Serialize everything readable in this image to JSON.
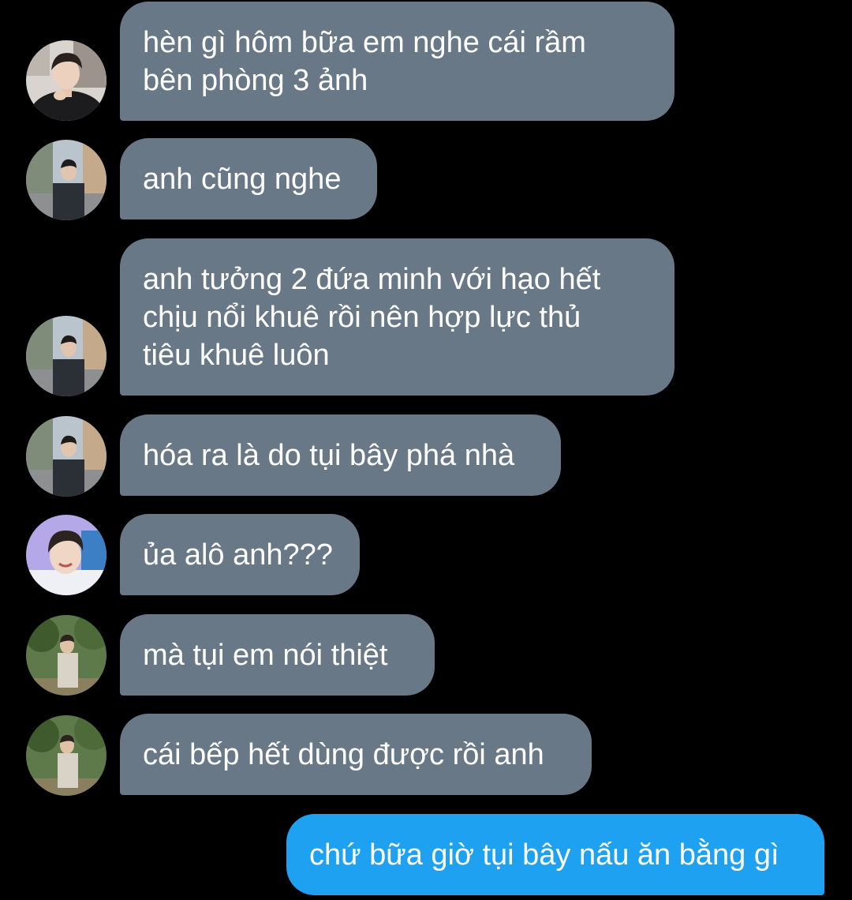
{
  "colors": {
    "background": "#000000",
    "incoming_bubble": "#697887",
    "outgoing_bubble": "#1fa1f2",
    "text": "#ffffff"
  },
  "messages": [
    {
      "direction": "incoming",
      "avatar": "avatar-dark-jacket",
      "text": "hèn gì hôm bữa em nghe cái rầm\nbên phòng 3 ảnh"
    },
    {
      "direction": "incoming",
      "avatar": "avatar-street",
      "text": "anh cũng nghe"
    },
    {
      "direction": "incoming",
      "avatar": "avatar-street",
      "text": "anh tưởng 2 đứa minh với hạo hết\nchịu nổi khuê rồi nên hợp lực thủ\ntiêu khuê luôn"
    },
    {
      "direction": "incoming",
      "avatar": "avatar-street",
      "text": "hóa ra là do tụi bây phá nhà"
    },
    {
      "direction": "incoming",
      "avatar": "avatar-smiling",
      "text": "ủa alô anh???"
    },
    {
      "direction": "incoming",
      "avatar": "avatar-park",
      "text": "mà tụi em nói thiệt"
    },
    {
      "direction": "incoming",
      "avatar": "avatar-park",
      "text": "cái bếp hết dùng được rồi anh"
    },
    {
      "direction": "outgoing",
      "text": "chứ bữa giờ tụi bây nấu ăn bằng gì"
    }
  ]
}
